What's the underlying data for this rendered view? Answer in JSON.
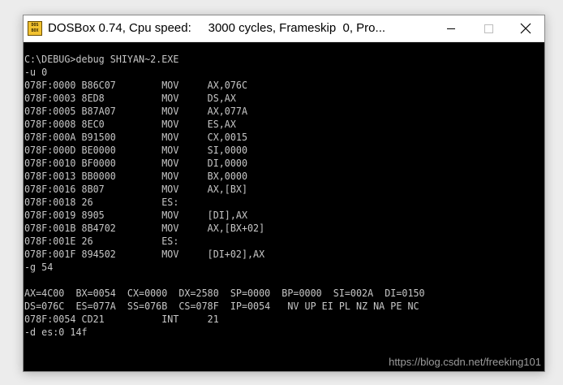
{
  "window": {
    "title": "DOSBox 0.74, Cpu speed:     3000 cycles, Frameskip  0, Pro...",
    "icon_text": "DOS BOX",
    "controls": {
      "minimize": "minimize-icon",
      "maximize": "maximize-icon",
      "close": "close-icon"
    }
  },
  "console": {
    "lines": [
      "C:\\DEBUG>debug SHIYAN~2.EXE",
      "-u 0",
      "078F:0000 B86C07        MOV     AX,076C",
      "078F:0003 8ED8          MOV     DS,AX",
      "078F:0005 B87A07        MOV     AX,077A",
      "078F:0008 8EC0          MOV     ES,AX",
      "078F:000A B91500        MOV     CX,0015",
      "078F:000D BE0000        MOV     SI,0000",
      "078F:0010 BF0000        MOV     DI,0000",
      "078F:0013 BB0000        MOV     BX,0000",
      "078F:0016 8B07          MOV     AX,[BX]",
      "078F:0018 26            ES:",
      "078F:0019 8905          MOV     [DI],AX",
      "078F:001B 8B4702        MOV     AX,[BX+02]",
      "078F:001E 26            ES:",
      "078F:001F 894502        MOV     [DI+02],AX",
      "-g 54",
      "",
      "AX=4C00  BX=0054  CX=0000  DX=2580  SP=0000  BP=0000  SI=002A  DI=0150",
      "DS=076C  ES=077A  SS=076B  CS=078F  IP=0054   NV UP EI PL NZ NA PE NC",
      "078F:0054 CD21          INT     21",
      "-d es:0 14f"
    ]
  },
  "watermark": "https://blog.csdn.net/freeking101"
}
